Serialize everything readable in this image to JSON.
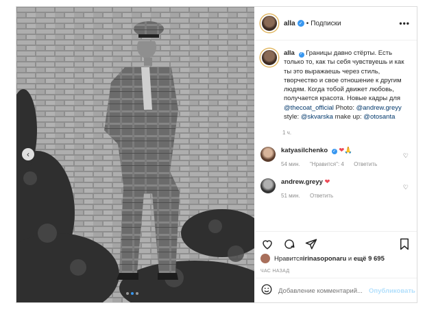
{
  "post": {
    "author": "alla",
    "follow_separator": "•",
    "follow_label": "Подписки",
    "more_label": "•••",
    "nav_prev_label": "‹",
    "caption": {
      "text_pre": "Границы давно стёрты. Есть только то, как ты себя чувствуешь и как ты это выражаешь через стиль, творчество и свое отношение к другим людям. Когда тобой движет любовь, получается красота. Новые кадры для ",
      "tag1": "@thecoat_official",
      "text_mid1": " Photo: ",
      "tag2": "@andrew.greyy",
      "text_mid2": " style: ",
      "tag3": "@skvarska",
      "text_mid3": " make up: ",
      "tag4": "@otosanta",
      "time": "1 ч."
    },
    "comments": [
      {
        "user": "katyasilchenko",
        "emoji": "❤🙏",
        "time": "54 мин.",
        "likes": "\"Нравится\": 4",
        "reply": "Ответить"
      },
      {
        "user": "andrew.greyy",
        "emoji": "❤",
        "time": "51 мин.",
        "reply": "Ответить"
      }
    ],
    "likes_prefix": "Нравится ",
    "likes_user": "irinasoponaru",
    "likes_mid": " и ",
    "likes_count": "ещё 9 695",
    "ago": "ЧАС НАЗАД",
    "add_comment_placeholder": "Добавление комментарий...",
    "publish_label": "Опубликовать"
  },
  "icons": [
    "heart-icon",
    "comment-icon",
    "share-icon",
    "bookmark-icon",
    "emoji-icon",
    "verified-icon"
  ]
}
